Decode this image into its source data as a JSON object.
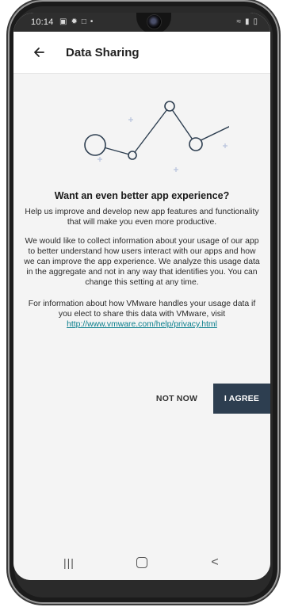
{
  "status_bar": {
    "time": "10:14",
    "left_icons": [
      "image-icon",
      "gear-icon",
      "screenshot-icon",
      "dot-icon"
    ],
    "right_icons": [
      "wifi-icon",
      "signal-icon",
      "battery-icon"
    ]
  },
  "app_bar": {
    "back_icon": "arrow-left-icon",
    "title": "Data Sharing"
  },
  "content": {
    "heading": "Want an even better app experience?",
    "paragraph1": "Help us improve and develop new app features and functionality that will make you even more productive.",
    "paragraph2": "We would like to collect information about your usage of our app to better understand how users interact with our apps and how we can improve the app experience. We analyze this usage data in the aggregate and not in any way that identifies you. You can change this setting at any time.",
    "paragraph3_prefix": "For information about how VMware handles your usage data if you elect to share this data with VMware, visit",
    "privacy_link": "http://www.vmware.com/help/privacy.html"
  },
  "buttons": {
    "not_now": "NOT NOW",
    "agree": "I AGREE"
  },
  "nav_bar": {
    "recents_label": "|||",
    "back_label": "<"
  },
  "colors": {
    "primary_button": "#2d3e50",
    "link": "#0a7e8c",
    "illustration_line": "#2d3e50",
    "illustration_plus": "#b8c3dc"
  }
}
